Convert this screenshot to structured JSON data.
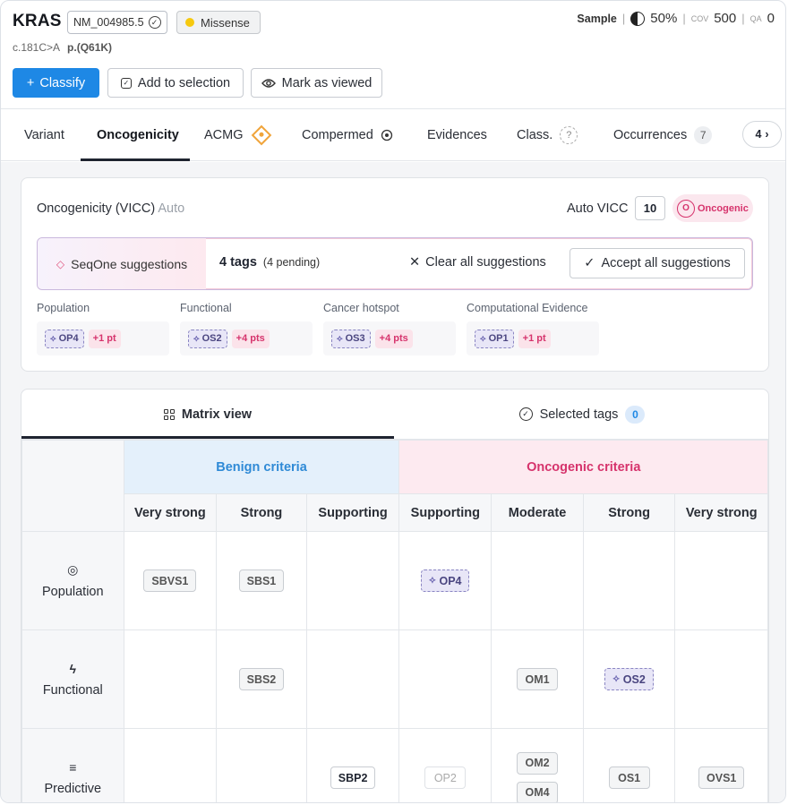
{
  "header": {
    "gene": "KRAS",
    "transcript": "NM_004985.5",
    "consequence": "Missense",
    "consequence_color": "#f6c90e",
    "cdna": "c.181C>A",
    "protein": "p.(Q61K)",
    "sample_label": "Sample",
    "sample_sep": "|",
    "vaf": "50%",
    "cov_label": "COV",
    "cov_value": "500",
    "qa_label": "QA",
    "qa_value": "0",
    "classify_label": "Classify",
    "add_selection_label": "Add to selection",
    "mark_viewed_label": "Mark as viewed",
    "primary_color": "#1e88e5"
  },
  "tabs": {
    "variant": "Variant",
    "oncogenicity": "Oncogenicity",
    "acmg": "ACMG",
    "compermed": "Compermed",
    "evidences": "Evidences",
    "class": "Class.",
    "class_badge": "?",
    "occurrences": "Occurrences",
    "occurrences_count": "7",
    "more_count": "4"
  },
  "oncogenicity": {
    "title": "Oncogenicity (VICC)",
    "title_suffix": "Auto",
    "auto_vicc_label": "Auto VICC",
    "auto_vicc_score": "10",
    "classification_letter": "O",
    "classification_label": "Oncogenic",
    "classification_color": "#d6336c",
    "suggestions": {
      "source": "SeqOne suggestions",
      "tags_count": "4 tags",
      "pending": "(4 pending)",
      "clear_label": "Clear all suggestions",
      "accept_label": "Accept all suggestions"
    },
    "categories": [
      {
        "title": "Population",
        "tag": "OP4",
        "points": "+1 pt"
      },
      {
        "title": "Functional",
        "tag": "OS2",
        "points": "+4 pts"
      },
      {
        "title": "Cancer hotspot",
        "tag": "OS3",
        "points": "+4 pts"
      },
      {
        "title": "Computational Evidence",
        "tag": "OP1",
        "points": "+1 pt"
      }
    ]
  },
  "matrix": {
    "view_tab": "Matrix view",
    "selected_tab": "Selected tags",
    "selected_count": "0",
    "benign_header": "Benign criteria",
    "oncogenic_header": "Oncogenic criteria",
    "levels": [
      "Very strong",
      "Strong",
      "Supporting",
      "Supporting",
      "Moderate",
      "Strong",
      "Very strong"
    ],
    "rows": [
      {
        "label": "Population",
        "icon": "population-icon",
        "cells": [
          [
            "SBVS1"
          ],
          [
            "SBS1"
          ],
          [],
          [
            "OP4"
          ],
          [],
          [],
          []
        ]
      },
      {
        "label": "Functional",
        "icon": "functional-icon",
        "cells": [
          [],
          [
            "SBS2"
          ],
          [],
          [],
          [
            "OM1"
          ],
          [
            "OS2"
          ],
          []
        ]
      },
      {
        "label": "Predictive",
        "icon": "predictive-icon",
        "cells": [
          [],
          [],
          [
            "SBP2"
          ],
          [
            "OP2"
          ],
          [
            "OM2",
            "OM4"
          ],
          [
            "OS1"
          ],
          [
            "OVS1"
          ]
        ]
      }
    ]
  }
}
